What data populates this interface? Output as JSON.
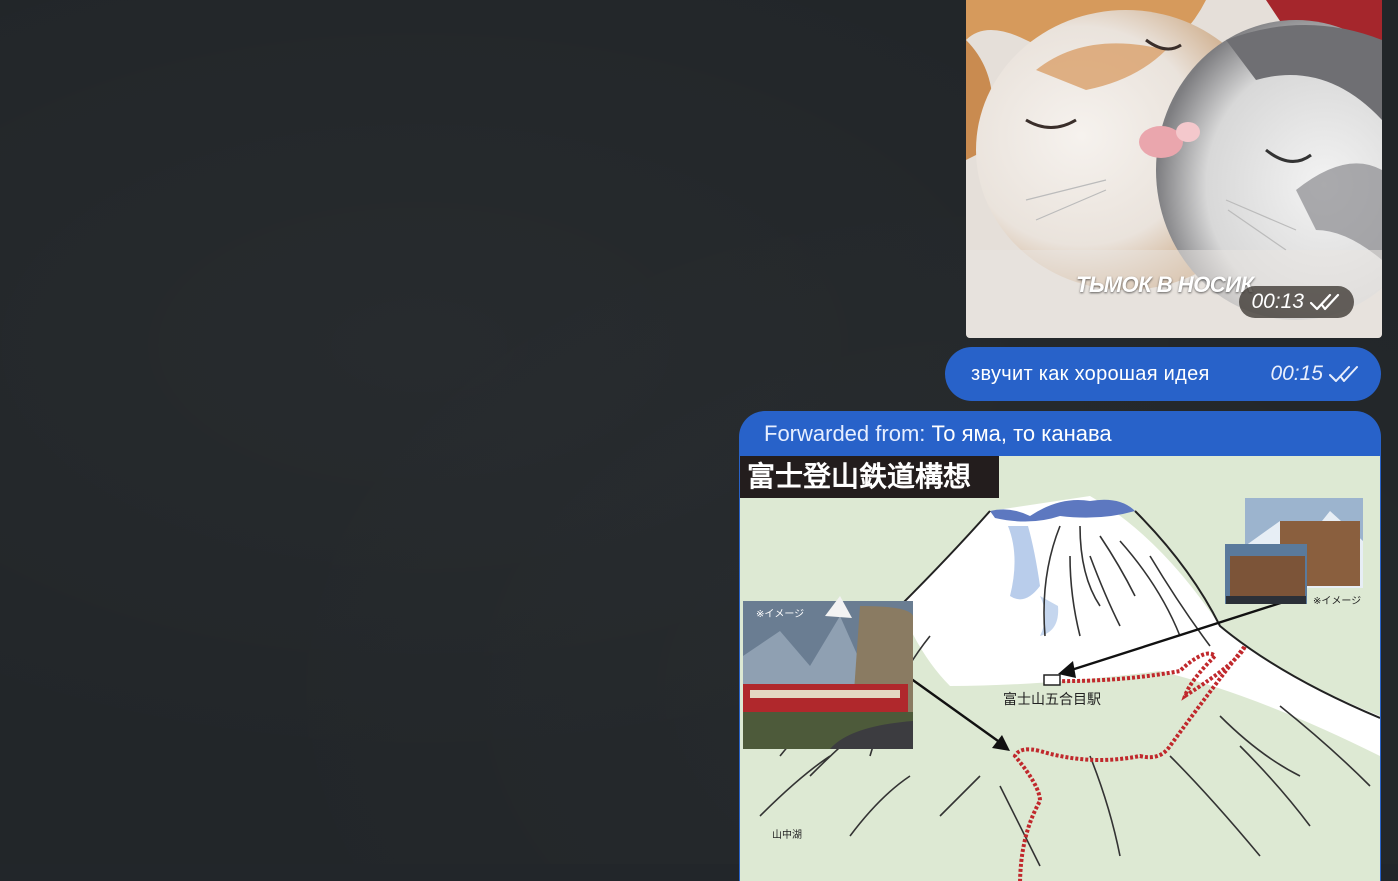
{
  "messages": {
    "video": {
      "caption": "ТЬМОК В НОСИК",
      "time": "00:13",
      "status_icon": "double-check-icon"
    },
    "text": {
      "body": "звучит как хорошая идея",
      "time": "00:15",
      "status_icon": "double-check-icon"
    },
    "forwarded": {
      "prefix": "Forwarded from:",
      "source": "То яма, то канава",
      "image": {
        "title": "富士登山鉄道構想",
        "station_label": "富士山五合目駅",
        "image_note_left": "※イメージ",
        "image_note_right": "※イメージ",
        "lake_label": "山中湖"
      }
    }
  },
  "colors": {
    "background": "#222629",
    "bubble": "#2862c9",
    "rail_route": "#c0282c"
  }
}
